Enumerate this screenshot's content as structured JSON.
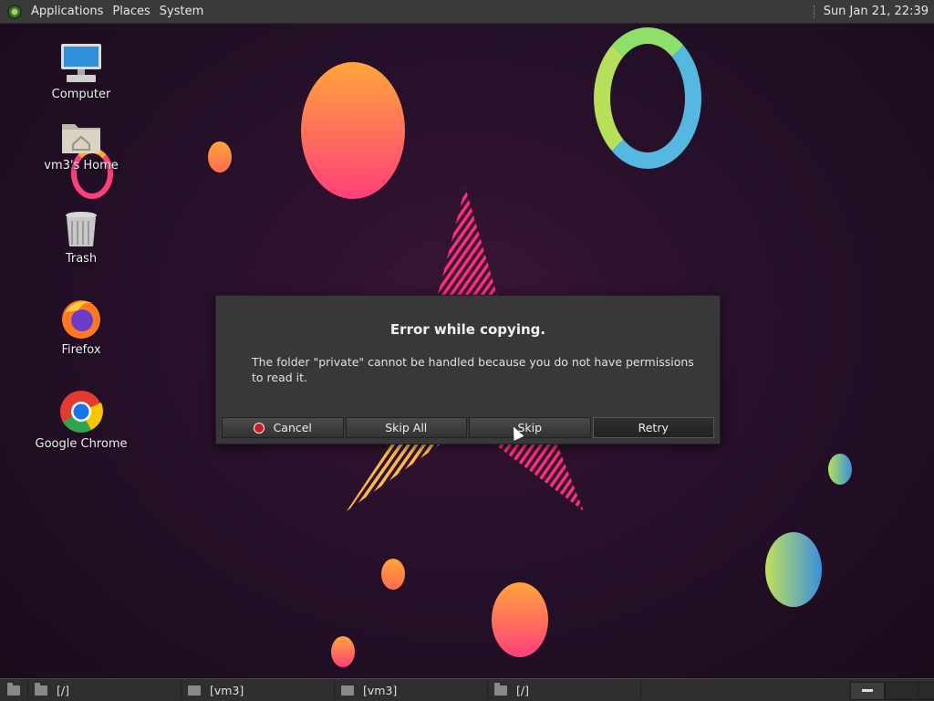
{
  "top_panel": {
    "menus": [
      "Applications",
      "Places",
      "System"
    ],
    "clock": "Sun Jan 21, 22:39"
  },
  "desktop": {
    "icons": [
      {
        "label": "Computer",
        "icon": "computer-icon"
      },
      {
        "label": "vm3's Home",
        "icon": "home-folder-icon"
      },
      {
        "label": "Trash",
        "icon": "trash-icon"
      },
      {
        "label": "Firefox",
        "icon": "firefox-icon"
      },
      {
        "label": "Google Chrome",
        "icon": "chrome-icon"
      }
    ]
  },
  "dialog": {
    "title": "Error while copying.",
    "message": "The folder \"private\" cannot be handled because you do not have permissions to read it.",
    "buttons": {
      "cancel": "Cancel",
      "skip_all": "Skip All",
      "skip": "Skip",
      "retry": "Retry"
    }
  },
  "taskbar": {
    "tasks": [
      {
        "label": "[/]",
        "icon": "folder-icon"
      },
      {
        "label": "[vm3]",
        "icon": "home-icon"
      },
      {
        "label": "[vm3]",
        "icon": "home-icon"
      },
      {
        "label": "[/]",
        "icon": "folder-icon"
      }
    ]
  },
  "colors": {
    "panel": "#3a3a3a",
    "dialog": "#383838",
    "accent_red": "#c81e1e"
  }
}
